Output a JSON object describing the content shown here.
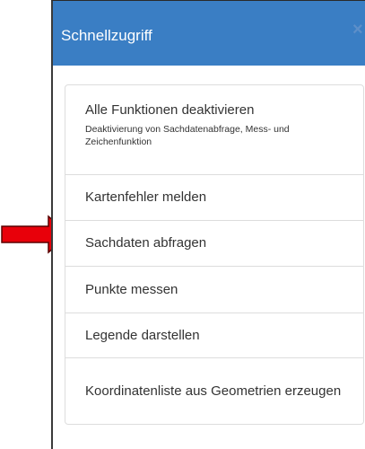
{
  "panel": {
    "title": "Schnellzugriff",
    "close_symbol": "×"
  },
  "menu": {
    "items": [
      {
        "label": "Alle Funktionen deaktivieren",
        "description": "Deaktivierung von Sachdatenabfrage, Mess- und Zeichenfunktion"
      },
      {
        "label": "Kartenfehler melden"
      },
      {
        "label": "Sachdaten abfragen"
      },
      {
        "label": "Punkte messen"
      },
      {
        "label": "Legende darstellen"
      },
      {
        "label": "Koordinatenliste aus Geometrien erzeugen"
      }
    ]
  },
  "colors": {
    "header_background": "#3a7ec4",
    "header_text": "#ffffff",
    "pointer_arrow": "#e8000a"
  },
  "icons": {
    "close": "close-icon",
    "pointer": "red-arrow-icon"
  }
}
